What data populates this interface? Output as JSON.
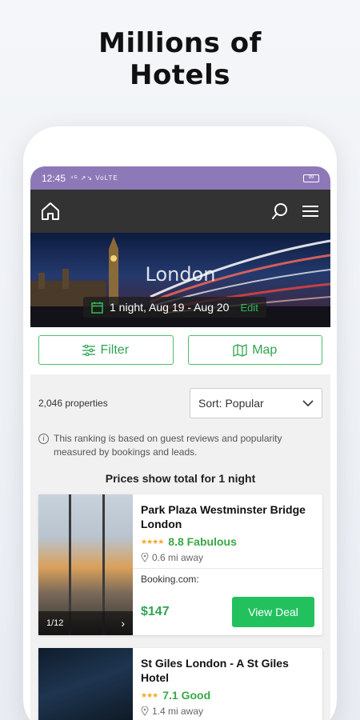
{
  "headline": {
    "line1": "Millions of",
    "line2": "Hotels"
  },
  "statusbar": {
    "time": "12:45",
    "signal": "⁴ᴳ ↗↘ VoLTE",
    "battery": "99"
  },
  "appbar": {
    "home_icon": "home-icon",
    "search_icon": "search-icon",
    "menu_icon": "menu-icon"
  },
  "hero": {
    "city": "London",
    "dates": "1 night, Aug 19 - Aug 20",
    "edit_label": "Edit",
    "calendar_icon": "calendar-icon"
  },
  "actions": {
    "filter_label": "Filter",
    "map_label": "Map",
    "accent": "#2fa552"
  },
  "results": {
    "count": "2,046 properties",
    "sort_value": "Sort: Popular",
    "info_text": "This ranking is based on guest reviews and popularity measured by bookings and leads.",
    "prices_note": "Prices show total for 1 night"
  },
  "hotels": [
    {
      "name": "Park Plaza Westminster Bridge London",
      "stars": "★★★★",
      "score": "8.8 Fabulous",
      "distance": "0.6 mi away",
      "provider": "Booking.com:",
      "price": "$147",
      "deal_label": "View Deal",
      "gallery": "1/12"
    },
    {
      "name": "St Giles London - A St Giles Hotel",
      "stars": "★★★",
      "score": "7.1 Good",
      "distance": "1.4 mi away"
    }
  ]
}
